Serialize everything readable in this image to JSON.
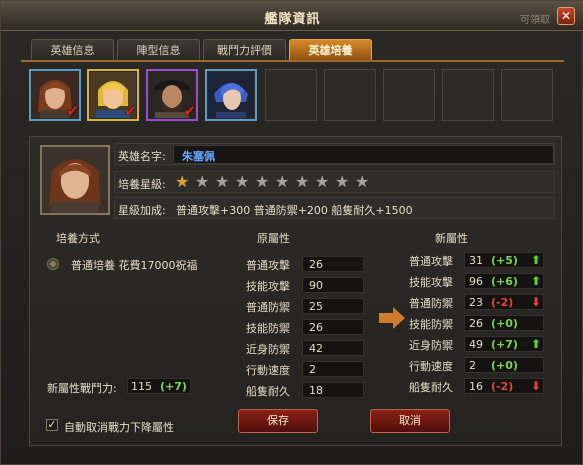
{
  "window": {
    "title": "艦隊資訊",
    "background_button": "可領取",
    "close_label": "✕"
  },
  "tabs": [
    {
      "label": "英雄信息",
      "active": false
    },
    {
      "label": "陣型信息",
      "active": false
    },
    {
      "label": "戰鬥力評價",
      "active": false
    },
    {
      "label": "英雄培養",
      "active": true
    }
  ],
  "roster": {
    "heroes": [
      {
        "portrait": "young-man-brown-hair",
        "frame_color": "#5d9bc4",
        "selected": true
      },
      {
        "portrait": "blonde-man",
        "frame_color": "#d7b247",
        "selected": true
      },
      {
        "portrait": "bearded-man-hat",
        "frame_color": "#9a4bd2",
        "selected": true
      },
      {
        "portrait": "blue-hair-man",
        "frame_color": "#5d9bc4",
        "selected": false
      }
    ],
    "empty_slots": 5
  },
  "hero": {
    "name_label": "英雄名字:",
    "name": "朱塞佩",
    "star_label": "培養星級:",
    "stars_total": 10,
    "stars_on": 1,
    "bonus_label": "星級加成:",
    "bonus_text": "普通攻擊+300    普通防禦+200    船隻耐久+1500"
  },
  "training": {
    "method_header": "培養方式",
    "method_text": "普通培養  花費17000祝福",
    "old_header": "原屬性",
    "new_header": "新屬性",
    "power_label": "新屬性戰鬥力:",
    "power_value": "115",
    "power_delta": "(+7)",
    "auto_cancel_label": "自動取消戰力下降屬性",
    "auto_cancel_checked": "✓",
    "save_label": "保存",
    "cancel_label": "取消"
  },
  "stats": [
    {
      "label": "普通攻擊",
      "old": "26",
      "new": "31",
      "delta": "(+5)",
      "trend": "up"
    },
    {
      "label": "技能攻擊",
      "old": "90",
      "new": "96",
      "delta": "(+6)",
      "trend": "up"
    },
    {
      "label": "普通防禦",
      "old": "25",
      "new": "23",
      "delta": "(-2)",
      "trend": "down"
    },
    {
      "label": "技能防禦",
      "old": "26",
      "new": "26",
      "delta": "(+0)",
      "trend": "none"
    },
    {
      "label": "近身防禦",
      "old": "42",
      "new": "49",
      "delta": "(+7)",
      "trend": "up"
    },
    {
      "label": "行動速度",
      "old": "2",
      "new": "2",
      "delta": "(+0)",
      "trend": "none"
    },
    {
      "label": "船隻耐久",
      "old": "18",
      "new": "16",
      "delta": "(-2)",
      "trend": "down"
    }
  ],
  "colors": {
    "accent_tab": "#d48a2a",
    "hero_name": "#67a7ff",
    "positive": "#7ad351",
    "negative": "#e5463c"
  }
}
